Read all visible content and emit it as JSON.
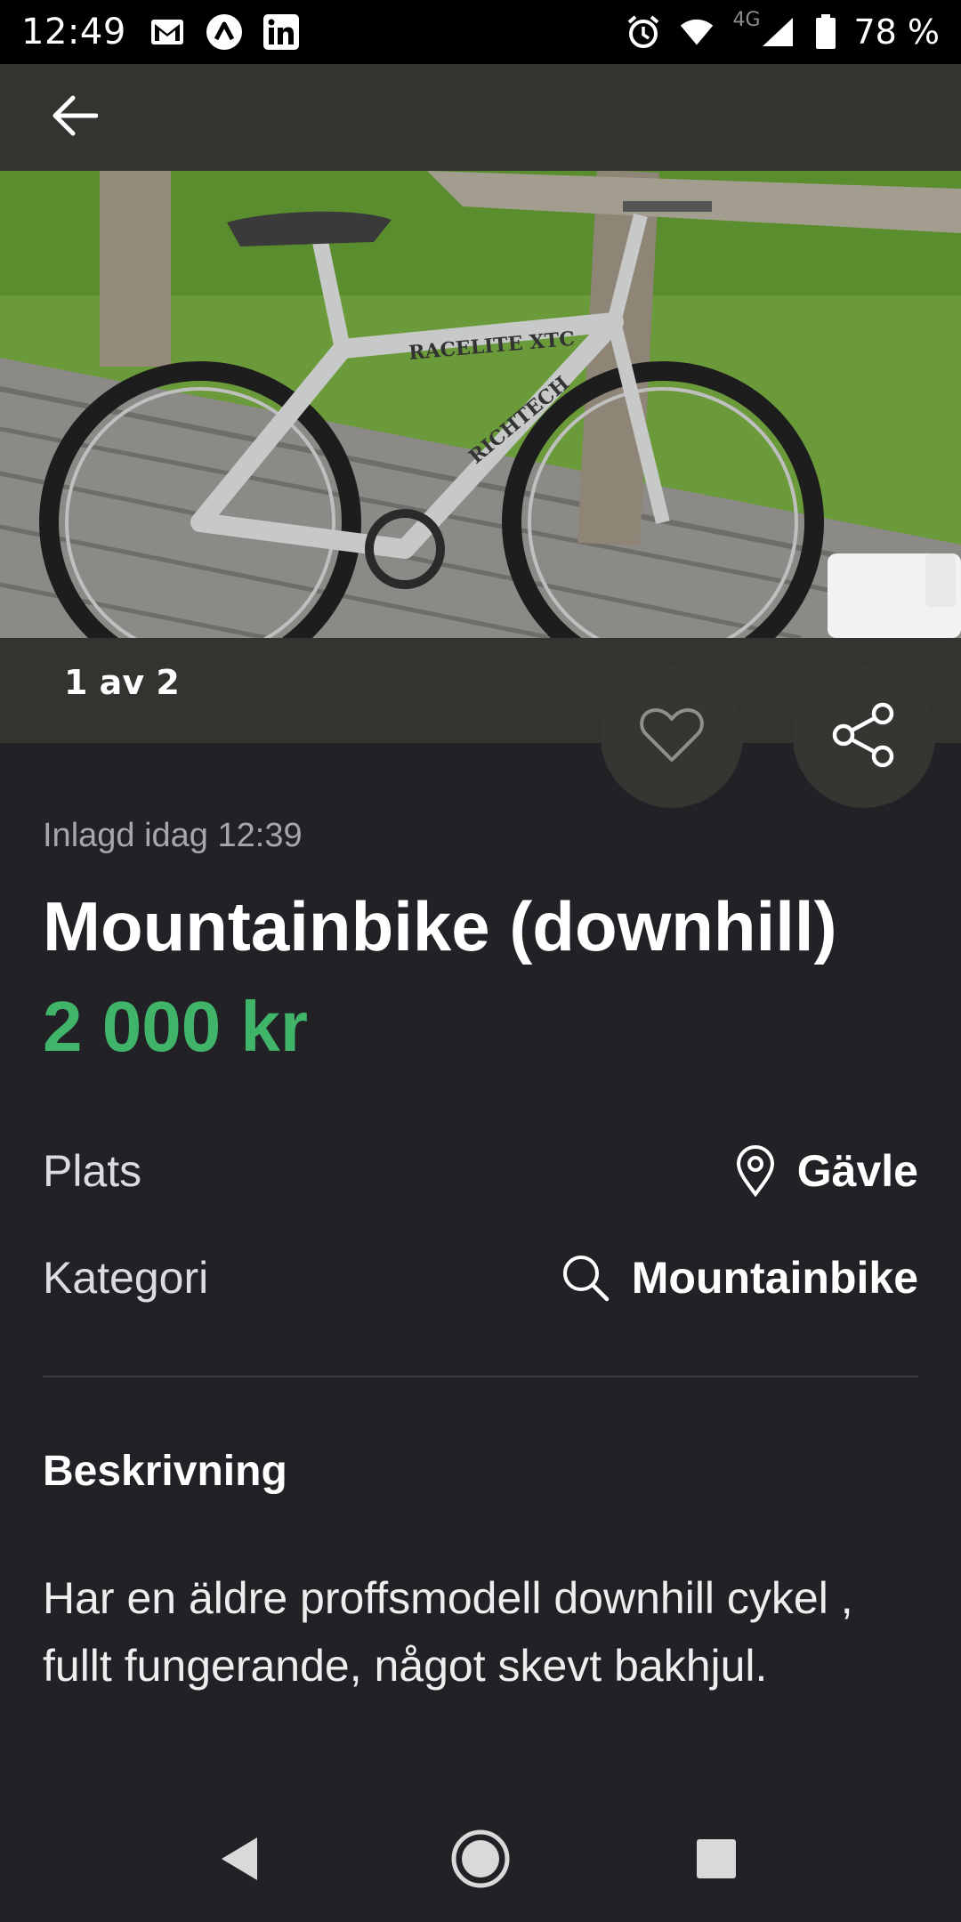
{
  "status_bar": {
    "time": "12:49",
    "network": "4G",
    "battery": "78 %",
    "icons": [
      "gmail-icon",
      "app-icon",
      "linkedin-icon",
      "alarm-icon",
      "wifi-icon",
      "signal-icon",
      "battery-icon"
    ]
  },
  "app_bar": {
    "back_icon": "arrow-left-icon"
  },
  "gallery": {
    "counter": "1 av 2"
  },
  "listing": {
    "posted": "Inlagd idag 12:39",
    "title": "Mountainbike (downhill)",
    "price": "2 000 kr"
  },
  "details": {
    "place_label": "Plats",
    "place_value": "Gävle",
    "category_label": "Kategori",
    "category_value": "Mountainbike"
  },
  "description": {
    "heading": "Beskrivning",
    "text": "Har en äldre proffsmodell downhill cykel , fullt fungerande,  något skevt bakhjul."
  },
  "colors": {
    "background": "#222126",
    "price": "#40b56a",
    "bar": "#343330"
  }
}
